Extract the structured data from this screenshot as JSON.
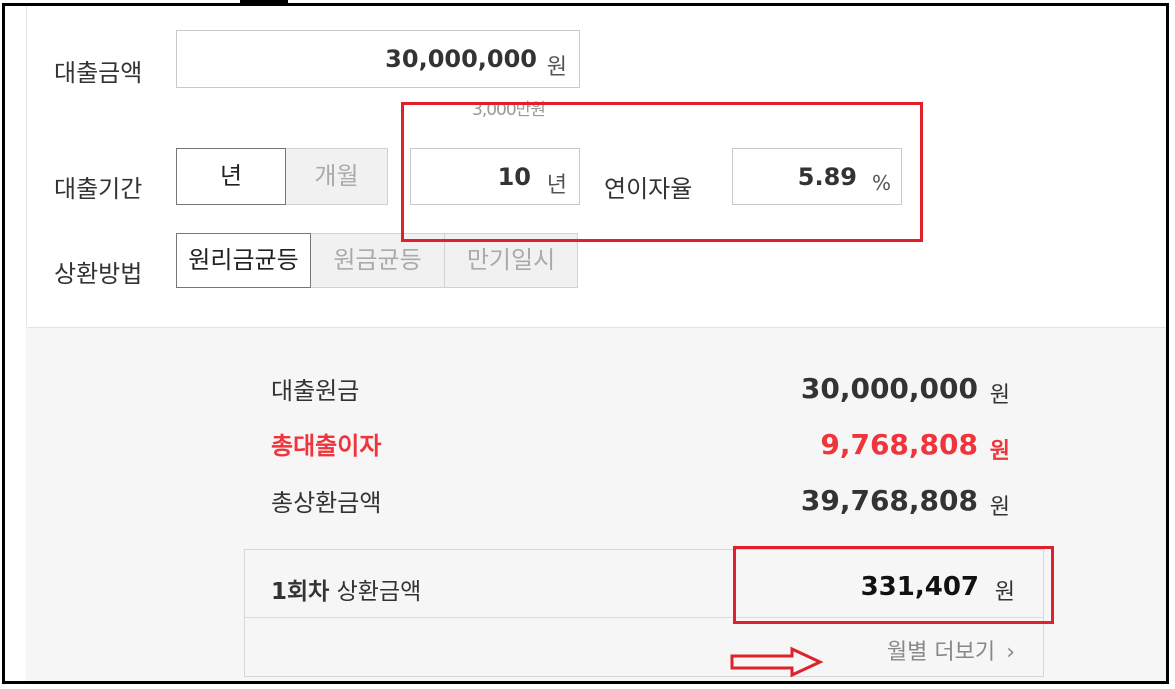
{
  "form": {
    "loan_amount": {
      "label": "대출금액",
      "value": "30,000,000",
      "unit": "원",
      "hint": "3,000만원"
    },
    "loan_period": {
      "label": "대출기간",
      "options": [
        "년",
        "개월"
      ],
      "selected": "년",
      "value": "10",
      "unit": "년"
    },
    "interest_rate": {
      "label": "연이자율",
      "value": "5.89",
      "unit": "%"
    },
    "repayment_method": {
      "label": "상환방법",
      "options": [
        "원리금균등",
        "원금균등",
        "만기일시"
      ],
      "selected": "원리금균등"
    }
  },
  "results": {
    "principal": {
      "label": "대출원금",
      "value": "30,000,000",
      "unit": "원"
    },
    "total_interest": {
      "label": "총대출이자",
      "value": "9,768,808",
      "unit": "원"
    },
    "total_repayment": {
      "label": "총상환금액",
      "value": "39,768,808",
      "unit": "원"
    },
    "first_payment": {
      "label_bold": "1회차",
      "label": "상환금액",
      "value": "331,407",
      "unit": "원"
    },
    "more_link": "월별 더보기"
  },
  "colors": {
    "highlight": "#e0212b",
    "interest_red": "#f0343c"
  }
}
